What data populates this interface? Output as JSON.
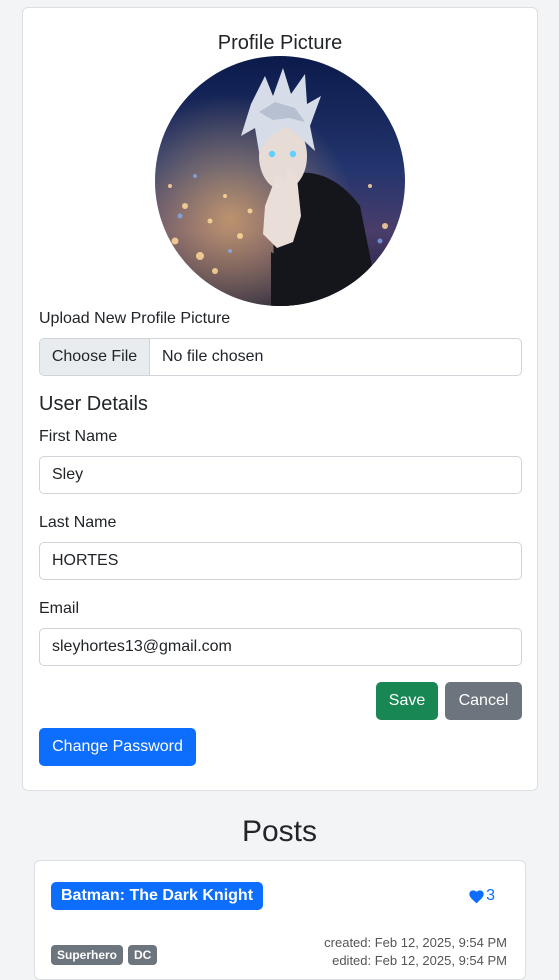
{
  "profile": {
    "title": "Profile Picture",
    "upload_label": "Upload New Profile Picture",
    "choose_file_label": "Choose File",
    "file_status": "No file chosen"
  },
  "user_details": {
    "title": "User Details",
    "first_name_label": "First Name",
    "first_name_value": "Sley",
    "last_name_label": "Last Name",
    "last_name_value": "HORTES",
    "email_label": "Email",
    "email_value": "sleyhortes13@gmail.com"
  },
  "actions": {
    "save_label": "Save",
    "cancel_label": "Cancel",
    "change_password_label": "Change Password"
  },
  "posts": {
    "title": "Posts",
    "items": [
      {
        "title": "Batman: The Dark Knight",
        "likes": "3",
        "tags": [
          "Superhero",
          "DC"
        ],
        "created": "created: Feb 12, 2025, 9:54 PM",
        "updated": "edited: Feb 12, 2025, 9:54 PM"
      }
    ]
  },
  "colors": {
    "primary": "#0d6efd",
    "success": "#198754",
    "secondary": "#6c757d"
  },
  "icons": {
    "like": "heart-icon"
  }
}
